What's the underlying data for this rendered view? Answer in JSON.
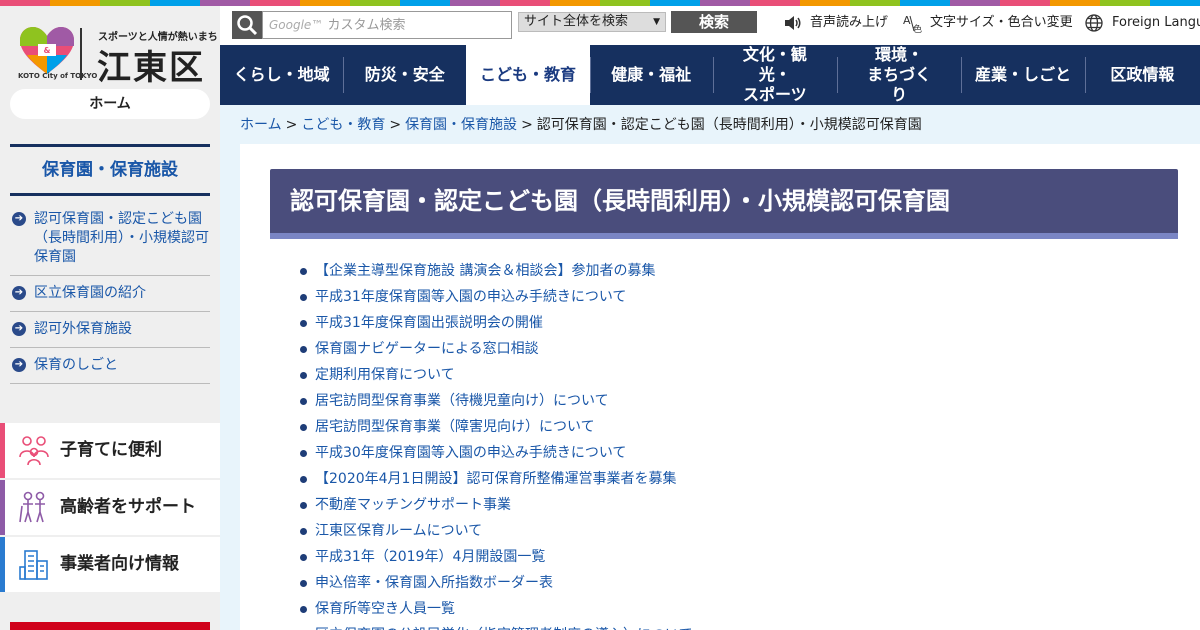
{
  "top_strip_colors": [
    "#e94e77",
    "#f39800",
    "#8fc31f",
    "#00a0e9",
    "#a05aa5",
    "#e94e77",
    "#f39800",
    "#8fc31f",
    "#00a0e9",
    "#a05aa5",
    "#e94e77",
    "#f39800",
    "#8fc31f",
    "#00a0e9",
    "#a05aa5",
    "#e94e77",
    "#f39800",
    "#8fc31f",
    "#00a0e9",
    "#a05aa5",
    "#e94e77",
    "#f39800",
    "#8fc31f",
    "#00a0e9"
  ],
  "logo": {
    "tagline": "スポーツと人情が熱いまち",
    "ward_name": "江東区",
    "sub": "KOTO City of TOKYO"
  },
  "home_button": "ホーム",
  "sidebar": {
    "section_title": "保育園・保育施設",
    "items": [
      {
        "label": "認可保育園・認定こども園（長時間利用）・小規模認可保育園",
        "icon": "arrow-right-circle-icon"
      },
      {
        "label": "区立保育園の紹介",
        "icon": "arrow-right-circle-icon"
      },
      {
        "label": "認可外保育施設",
        "icon": "arrow-right-circle-icon"
      },
      {
        "label": "保育のしごと",
        "icon": "arrow-right-circle-icon"
      }
    ],
    "features": [
      {
        "label": "子育てに便利",
        "icon": "family-icon",
        "color": "#e94e77"
      },
      {
        "label": "高齢者をサポート",
        "icon": "elderly-icon",
        "color": "#8e5ba7"
      },
      {
        "label": "事業者向け情報",
        "icon": "building-icon",
        "color": "#2a7bd0"
      }
    ]
  },
  "header": {
    "search_placeholder": "カスタム検索",
    "search_brand": "Google™",
    "scope": "サイト全体を検索",
    "search_button": "検索",
    "speech": "音声読み上げ",
    "text_size": "文字サイズ・色合い変更",
    "foreign": "Foreign Language"
  },
  "nav": [
    {
      "label": "くらし・地域",
      "active": false
    },
    {
      "label": "防災・安全",
      "active": false
    },
    {
      "label": "こども・教育",
      "active": true
    },
    {
      "label": "健康・福祉",
      "active": false
    },
    {
      "label": "文化・観光・スポーツ",
      "active": false
    },
    {
      "label": "環境・まちづくり",
      "active": false
    },
    {
      "label": "産業・しごと",
      "active": false
    },
    {
      "label": "区政情報",
      "active": false
    }
  ],
  "breadcrumb": {
    "home": "ホーム",
    "level1": "こども・教育",
    "level2": "保育園・保育施設",
    "current": "認可保育園・認定こども園（長時間利用）・小規模認可保育園",
    "separator": ">"
  },
  "page_title": "認可保育園・認定こども園（長時間利用）・小規模認可保育園",
  "links": [
    "【企業主導型保育施設 講演会＆相談会】参加者の募集",
    "平成31年度保育園等入園の申込み手続きについて",
    "平成31年度保育園出張説明会の開催",
    "保育園ナビゲーターによる窓口相談",
    "定期利用保育について",
    "居宅訪問型保育事業（待機児童向け）について",
    "居宅訪問型保育事業（障害児向け）について",
    "平成30年度保育園等入園の申込み手続きについて",
    "【2020年4月1日開設】認可保育所整備運営事業者を募集",
    "不動産マッチングサポート事業",
    "江東区保育ルームについて",
    "平成31年（2019年）4月開設園一覧",
    "申込倍率・保育園入所指数ボーダー表",
    "保育所等空き人員一覧",
    "区立保育園の公設民営化（指定管理者制度の導入）について"
  ]
}
